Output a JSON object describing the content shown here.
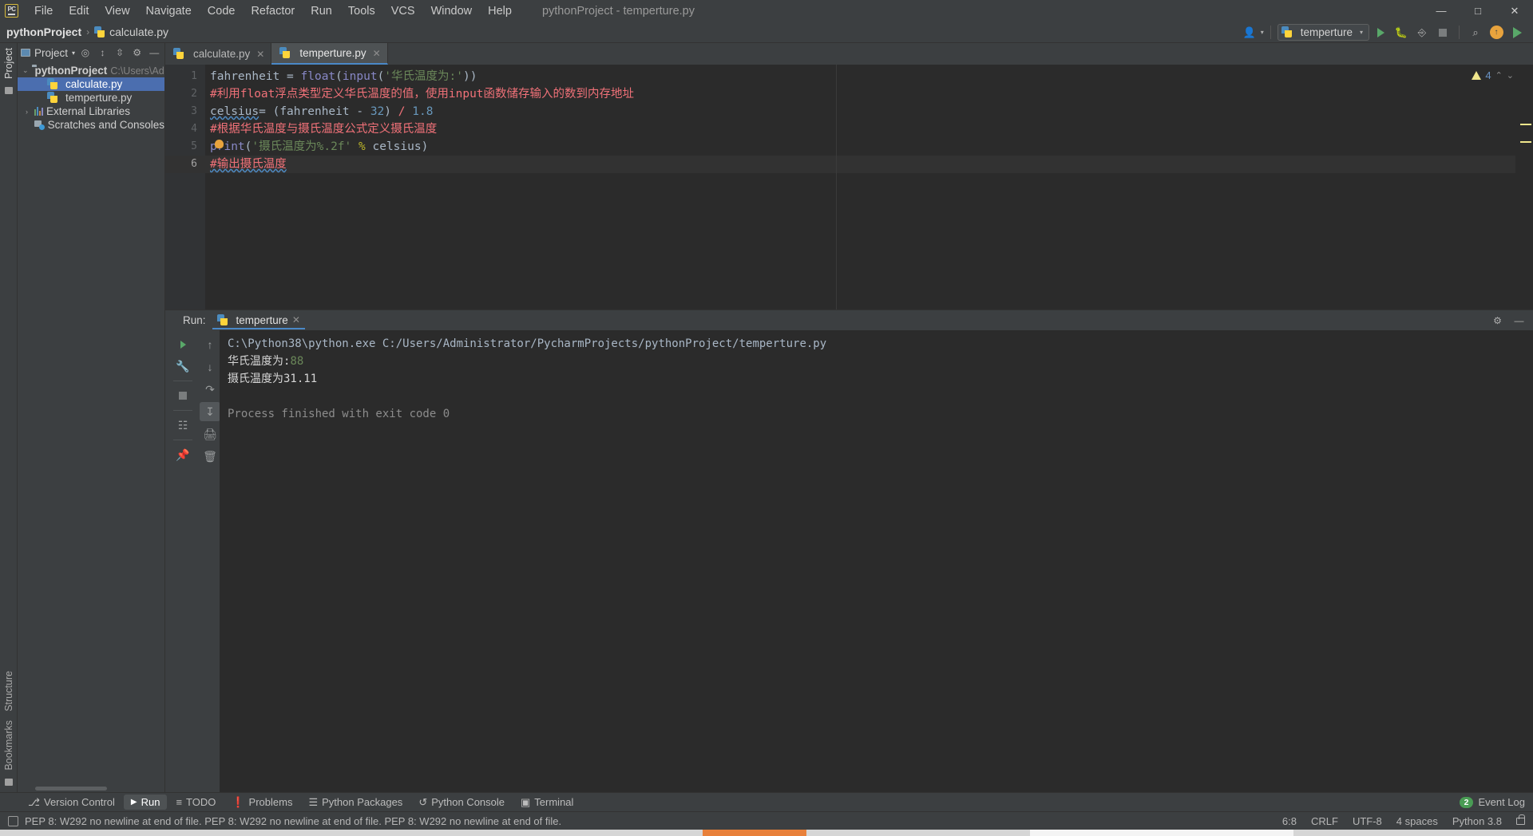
{
  "window": {
    "title": "pythonProject - temperture.py",
    "controls": {
      "minimize": "—",
      "maximize": "□",
      "close": "✕"
    }
  },
  "menu": {
    "items": [
      {
        "label": "File"
      },
      {
        "label": "Edit"
      },
      {
        "label": "View"
      },
      {
        "label": "Navigate"
      },
      {
        "label": "Code"
      },
      {
        "label": "Refactor"
      },
      {
        "label": "Run"
      },
      {
        "label": "Tools"
      },
      {
        "label": "VCS"
      },
      {
        "label": "Window"
      },
      {
        "label": "Help"
      }
    ]
  },
  "navbar": {
    "breadcrumb": {
      "project": "pythonProject",
      "separator": "›",
      "file": "calculate.py"
    },
    "run_config": {
      "name": "temperture",
      "caret": "▾"
    },
    "avatar_caret": "▾",
    "search_icon": "⌕"
  },
  "project_panel": {
    "title": "Project",
    "caret": "▾",
    "collapse": "—",
    "tree": [
      {
        "label": "pythonProject",
        "path": "C:\\Users\\Admini",
        "type": "root",
        "arrow": "⌄",
        "selected": false
      },
      {
        "label": "calculate.py",
        "path": "",
        "type": "pyfile",
        "arrow": "",
        "selected": true
      },
      {
        "label": "temperture.py",
        "path": "",
        "type": "pyfile",
        "arrow": "",
        "selected": false
      },
      {
        "label": "External Libraries",
        "path": "",
        "type": "lib",
        "arrow": "›",
        "selected": false
      },
      {
        "label": "Scratches and Consoles",
        "path": "",
        "type": "scratch",
        "arrow": "",
        "selected": false
      }
    ]
  },
  "left_strip": {
    "project_label": "Project",
    "structure_label": "Structure",
    "bookmarks_label": "Bookmarks"
  },
  "editor": {
    "tabs": [
      {
        "label": "calculate.py",
        "active": false,
        "close": "✕"
      },
      {
        "label": "temperture.py",
        "active": true,
        "close": "✕"
      }
    ],
    "lines": [
      {
        "no": "1",
        "current": false
      },
      {
        "no": "2",
        "current": false
      },
      {
        "no": "3",
        "current": false
      },
      {
        "no": "4",
        "current": false
      },
      {
        "no": "5",
        "current": false
      },
      {
        "no": "6",
        "current": true
      }
    ],
    "code": {
      "l1_var": "fahrenheit",
      "l1_eq": " = ",
      "l1_float": "float",
      "l1_p1": "(",
      "l1_input": "input",
      "l1_p2": "(",
      "l1_str": "'华氏温度为:'",
      "l1_p3": "))",
      "l2": "#利用float浮点类型定义华氏温度的值，使用input函数储存输入的数到内存地址",
      "l3_var": "celsius",
      "l3_eq": "= ",
      "l3_open": "(",
      "l3_f": "fahrenheit",
      "l3_minus": " - ",
      "l3_32": "32",
      "l3_close": ") ",
      "l3_div": "/",
      "l3_18": " 1.8",
      "l4": "#根据华氏温度与摄氏温度公式定义摄氏温度",
      "l5_print": "print",
      "l5_p1": "(",
      "l5_str": "'摄氏温度为%.2f'",
      "l5_pct": " % ",
      "l5_var": "celsius",
      "l5_p2": ")",
      "l6": "#输出摄氏温度"
    },
    "warnings": {
      "count": "4",
      "up": "⌃",
      "down": "⌄"
    }
  },
  "run_window": {
    "label": "Run:",
    "tab_name": "temperture",
    "tab_close": "✕",
    "settings_icon": "⚙",
    "hide_icon": "—",
    "console": {
      "command": "C:\\Python38\\python.exe C:/Users/Administrator/PycharmProjects/pythonProject/temperture.py",
      "line2_label": "华氏温度为:",
      "line2_value": "88",
      "line3": "摄氏温度为31.11",
      "line4": "",
      "finished": "Process finished with exit code 0"
    }
  },
  "tool_window_bar": {
    "items": [
      {
        "label": "Version Control",
        "icon": "⎇",
        "active": false
      },
      {
        "label": "Run",
        "icon": "▶",
        "active": true
      },
      {
        "label": "TODO",
        "icon": "≡",
        "active": false
      },
      {
        "label": "Problems",
        "icon": "❗",
        "active": false
      },
      {
        "label": "Python Packages",
        "icon": "☰",
        "active": false
      },
      {
        "label": "Python Console",
        "icon": "↺",
        "active": false
      },
      {
        "label": "Terminal",
        "icon": "▣",
        "active": false
      }
    ],
    "event_log": {
      "label": "Event Log",
      "count": "2"
    }
  },
  "status_bar": {
    "message": "PEP 8: W292 no newline at end of file. PEP 8: W292 no newline at end of file. PEP 8: W292 no newline at end of file.",
    "caret_position": "6:8",
    "line_separator": "CRLF",
    "encoding": "UTF-8",
    "indent": "4 spaces",
    "interpreter": "Python 3.8"
  },
  "colors": {
    "accent_blue": "#4b6eaf",
    "tab_underline": "#4a88c7",
    "run_green": "#59a869",
    "comment_red": "#f07178",
    "string_green": "#6a8759",
    "number_blue": "#6897bb",
    "function_yellow": "#ffc66d",
    "editor_bg": "#2b2b2b",
    "panel_bg": "#3c3f41"
  }
}
